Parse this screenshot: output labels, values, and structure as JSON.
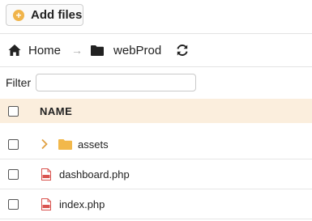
{
  "toolbar": {
    "add_files_label": "Add files",
    "add_icon": "plus-circle-icon",
    "accent_color": "#f0b44a"
  },
  "breadcrumb": {
    "home_label": "Home",
    "current_folder": "webProd",
    "separator_icon": "arrow-right-icon",
    "refresh_icon": "refresh-icon"
  },
  "filter": {
    "label": "Filter",
    "value": "",
    "placeholder": ""
  },
  "table": {
    "header_bg": "#fbeedd",
    "columns": [
      "NAME"
    ],
    "rows": [
      {
        "type": "folder",
        "name": "assets",
        "icon": "folder-icon"
      },
      {
        "type": "file",
        "name": "dashboard.php",
        "icon": "php-file-icon"
      },
      {
        "type": "file",
        "name": "index.php",
        "icon": "php-file-icon"
      }
    ]
  }
}
